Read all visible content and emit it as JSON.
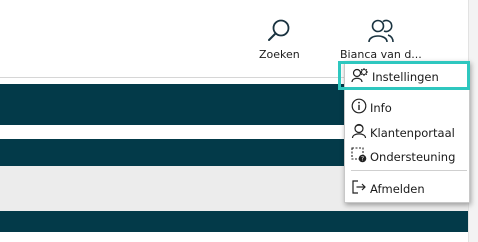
{
  "toolbar": {
    "search_label": "Zoeken",
    "user_label": "Bianca van d..."
  },
  "user_menu": {
    "items": [
      {
        "label": "Instellingen",
        "icon": "settings-gear-icon"
      },
      {
        "label": "Info",
        "icon": "info-icon"
      },
      {
        "label": "Klantenportaal",
        "icon": "customer-portal-icon"
      },
      {
        "label": "Ondersteuning",
        "icon": "support-icon"
      },
      {
        "label": "Afmelden",
        "icon": "logout-icon"
      }
    ]
  },
  "colors": {
    "header_band": "#033a49",
    "focus_outline": "#2ec7bf"
  }
}
